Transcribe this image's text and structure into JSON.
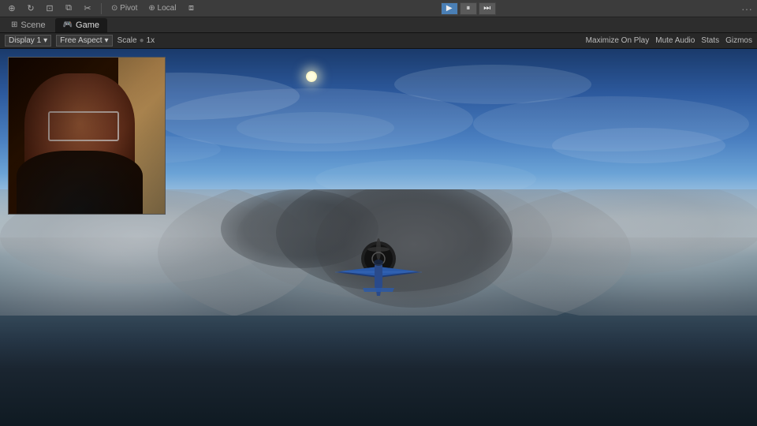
{
  "toolbar": {
    "dots": "···",
    "play_label": "▶",
    "pause_label": "⏸",
    "step_label": "⏭"
  },
  "tabs": [
    {
      "id": "scene",
      "label": "Scene",
      "icon": "⊞",
      "active": false
    },
    {
      "id": "game",
      "label": "Game",
      "icon": "🎮",
      "active": true
    }
  ],
  "game_toolbar": {
    "display_label": "Display 1",
    "aspect_label": "Free Aspect",
    "scale_label": "Scale",
    "scale_value": "1x",
    "maximize_label": "Maximize On Play",
    "mute_label": "Mute Audio",
    "stats_label": "Stats",
    "gizmos_label": "Gizmos"
  },
  "pip": {
    "visible": true
  }
}
